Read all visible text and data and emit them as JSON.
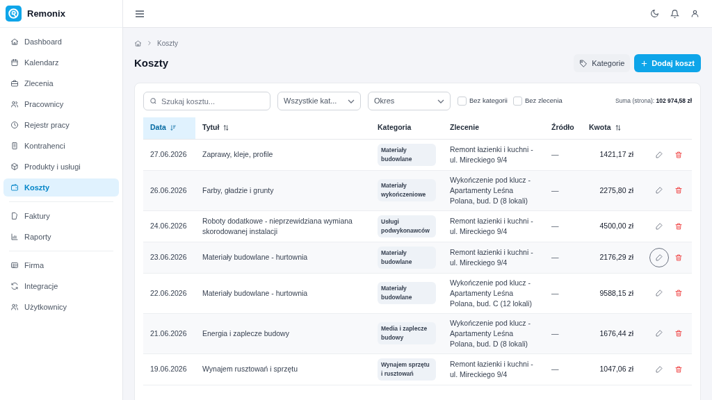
{
  "brand": {
    "name": "Remonix"
  },
  "nav": [
    [
      {
        "label": "Dashboard",
        "selected": false
      },
      {
        "label": "Kalendarz",
        "selected": false
      },
      {
        "label": "Zlecenia",
        "selected": false
      },
      {
        "label": "Pracownicy",
        "selected": false
      },
      {
        "label": "Rejestr pracy",
        "selected": false
      },
      {
        "label": "Kontrahenci",
        "selected": false
      },
      {
        "label": "Produkty i usługi",
        "selected": false
      },
      {
        "label": "Koszty",
        "selected": true
      }
    ],
    [
      {
        "label": "Faktury",
        "selected": false
      },
      {
        "label": "Raporty",
        "selected": false
      }
    ],
    [
      {
        "label": "Firma",
        "selected": false
      },
      {
        "label": "Integracje",
        "selected": false
      },
      {
        "label": "Użytkownicy",
        "selected": false
      }
    ]
  ],
  "breadcrumb": [
    "Koszty"
  ],
  "title": "Koszty",
  "actions": {
    "categories": "Kategorie",
    "add": "Dodaj koszt"
  },
  "filters": {
    "search_placeholder": "Szukaj kosztu...",
    "category": "Wszystkie kat...",
    "period": "Okres",
    "checkboxes": [
      {
        "label": "Bez kategorii",
        "checked": false
      },
      {
        "label": "Bez zlecenia",
        "checked": false
      }
    ],
    "sum_label": "Suma (strona):",
    "sum_value": "102 974,58 zł"
  },
  "columns": [
    {
      "label": "Data",
      "sortable": true,
      "selected": true
    },
    {
      "label": "Tytuł",
      "sortable": true,
      "selected": false
    },
    {
      "label": "Kategoria",
      "sortable": false,
      "selected": false
    },
    {
      "label": "Zlecenie",
      "sortable": false,
      "selected": false
    },
    {
      "label": "Źródło",
      "sortable": false,
      "selected": false
    },
    {
      "label": "Kwota",
      "sortable": true,
      "selected": false
    }
  ],
  "rows": [
    {
      "date": "27.06.2026",
      "title": "Zaprawy, kleje, profile",
      "category": "Materiały budowlane",
      "order": "Remont łazienki i kuchni - ul. Mireckiego 9/4",
      "source": "—",
      "amount": "1421,17 zł",
      "focused": false
    },
    {
      "date": "26.06.2026",
      "title": "Farby, gładzie i grunty",
      "category": "Materiały wykończeniowe",
      "order": "Wykończenie pod klucz - Apartamenty Leśna Polana, bud. D (8 lokali)",
      "source": "—",
      "amount": "2275,80 zł",
      "focused": false
    },
    {
      "date": "24.06.2026",
      "title": "Roboty dodatkowe - nieprzewidziana wymiana skorodowanej instalacji",
      "category": "Usługi podwykonawców",
      "order": "Remont łazienki i kuchni - ul. Mireckiego 9/4",
      "source": "—",
      "amount": "4500,00 zł",
      "focused": false
    },
    {
      "date": "23.06.2026",
      "title": "Materiały budowlane - hurtownia",
      "category": "Materiały budowlane",
      "order": "Remont łazienki i kuchni - ul. Mireckiego 9/4",
      "source": "—",
      "amount": "2176,29 zł",
      "focused": true
    },
    {
      "date": "22.06.2026",
      "title": "Materiały budowlane - hurtownia",
      "category": "Materiały budowlane",
      "order": "Wykończenie pod klucz - Apartamenty Leśna Polana, bud. C (12 lokali)",
      "source": "—",
      "amount": "9588,15 zł",
      "focused": false
    },
    {
      "date": "21.06.2026",
      "title": "Energia i zaplecze budowy",
      "category": "Media i zaplecze budowy",
      "order": "Wykończenie pod klucz - Apartamenty Leśna Polana, bud. D (8 lokali)",
      "source": "—",
      "amount": "1676,44 zł",
      "focused": false
    },
    {
      "date": "19.06.2026",
      "title": "Wynajem rusztowań i sprzętu",
      "category": "Wynajem sprzętu i rusztowań",
      "order": "Remont łazienki i kuchni - ul. Mireckiego 9/4",
      "source": "—",
      "amount": "1047,06 zł",
      "focused": false
    }
  ]
}
